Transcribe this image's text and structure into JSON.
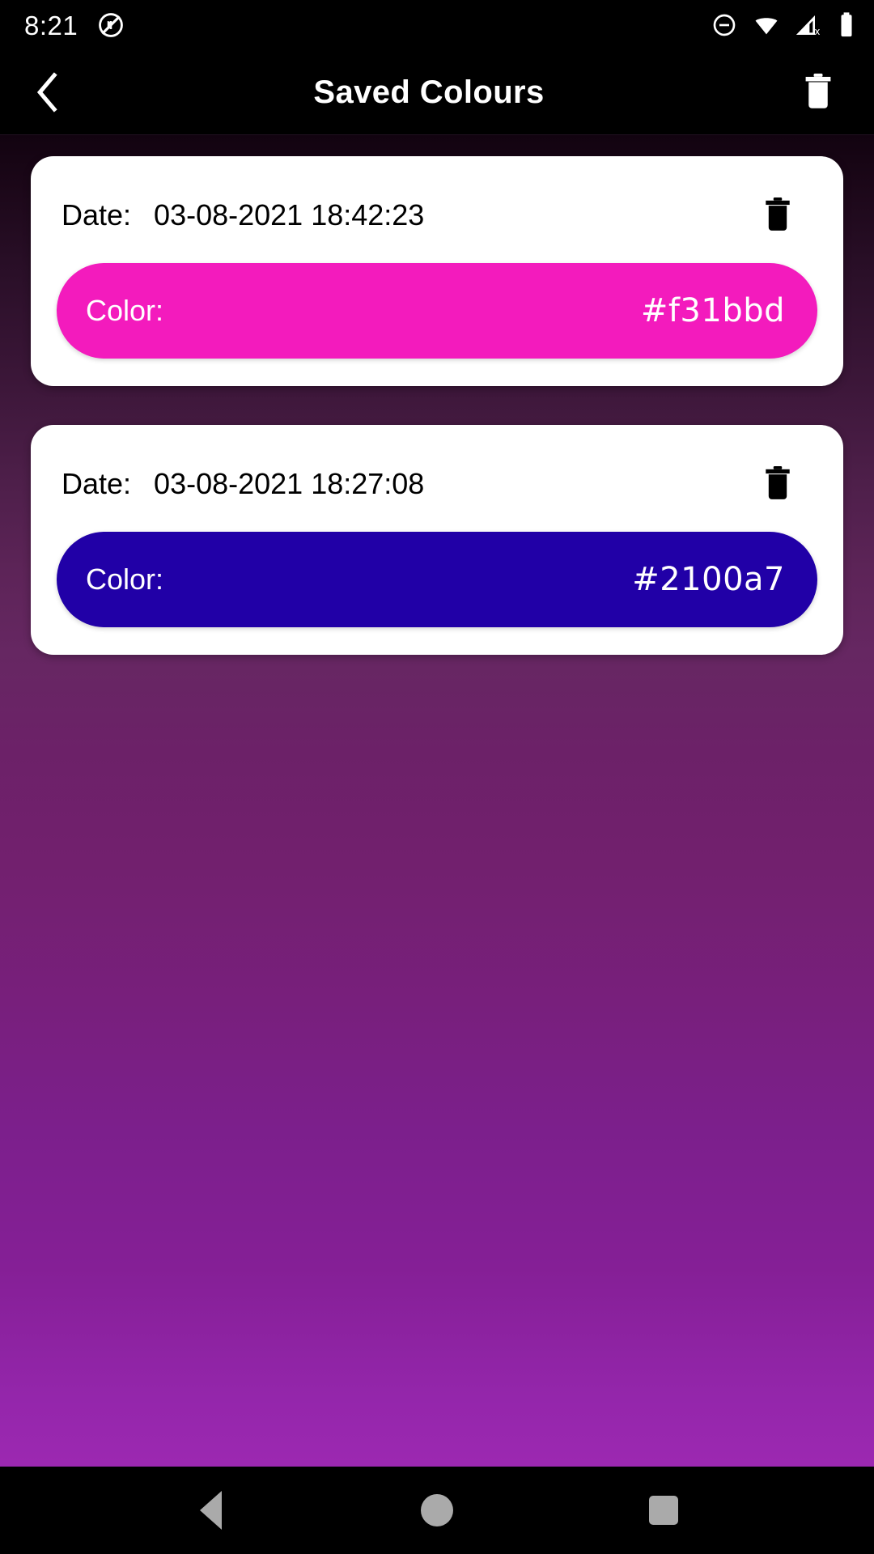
{
  "status_bar": {
    "time": "8:21",
    "icons_left": [
      "no-screenshot-icon"
    ],
    "icons_right": [
      "do-not-disturb-icon",
      "wifi-icon",
      "cell-signal-off-icon",
      "battery-full-icon"
    ]
  },
  "app_bar": {
    "back_icon": "chevron-left-icon",
    "title": "Saved Colours",
    "delete_all_icon": "trash-icon"
  },
  "colors": {
    "app_bar_bg": "#000000",
    "card_bg": "#ffffff",
    "background_top": "#120310",
    "background_bottom": "#a52bb8",
    "nav_icon": "#aaaaaa"
  },
  "saved_colours": [
    {
      "date_label": "Date:",
      "date_value": "03-08-2021 18:42:23",
      "color_label": "Color:",
      "hex": "#f31bbd",
      "swatch_color": "#f31bbd",
      "delete_icon": "trash-icon"
    },
    {
      "date_label": "Date:",
      "date_value": "03-08-2021 18:27:08",
      "color_label": "Color:",
      "hex": "#2100a7",
      "swatch_color": "#2100a7",
      "delete_icon": "trash-icon"
    }
  ],
  "nav_bar": {
    "back": "back-triangle-icon",
    "home": "home-circle-icon",
    "recents": "recents-square-icon"
  }
}
